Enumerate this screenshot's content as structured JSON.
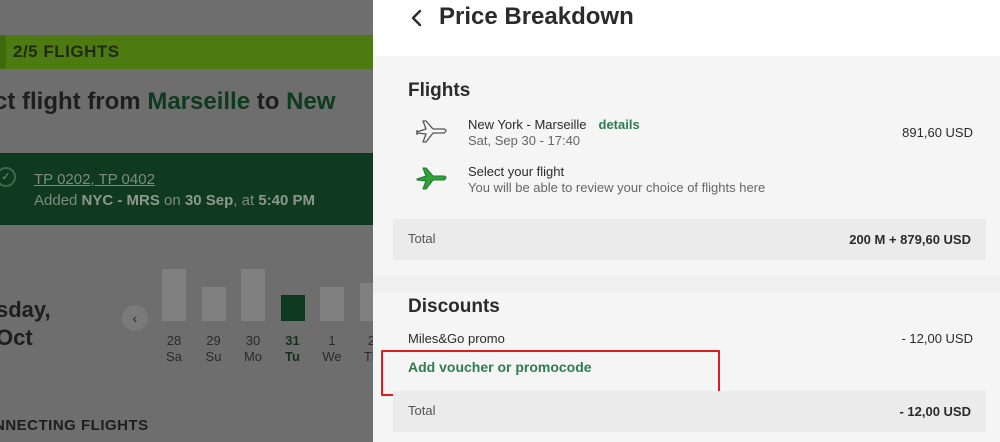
{
  "background": {
    "step_label": "2/5 FLIGHTS",
    "heading_prefix": "ct flight from ",
    "heading_origin": "Marseille",
    "heading_to": " to ",
    "heading_dest": "New",
    "selected_codes": "TP 0202, TP 0402",
    "selected_added_prefix": "Added ",
    "selected_route": "NYC - MRS",
    "selected_on": " on ",
    "selected_date": "30 Sep",
    "selected_at": ", at ",
    "selected_time": "5:40 PM",
    "date_line1": "sday,",
    "date_line2": "Oct",
    "arrow": "‹",
    "calendar": [
      {
        "day": "28",
        "dow": "Sa",
        "level": 0.58
      },
      {
        "day": "29",
        "dow": "Su",
        "level": 0.38
      },
      {
        "day": "30",
        "dow": "Mo",
        "level": 0.58
      },
      {
        "day": "31",
        "dow": "Tu",
        "level": 0.29,
        "selected": true
      },
      {
        "day": "1",
        "dow": "We",
        "level": 0.38
      },
      {
        "day": "2",
        "dow": "Th",
        "level": 0.42
      }
    ],
    "connecting_label": "NNECTING FLIGHTS"
  },
  "panel": {
    "title": "Price Breakdown",
    "flights": {
      "title": "Flights",
      "items": [
        {
          "route": "New York - Marseille",
          "link": "details",
          "date": "Sat, Sep 30 - 17:40",
          "price": "891,60 USD"
        },
        {
          "route": "Select your flight",
          "date": "You will be able to review your choice of flights here",
          "price": ""
        }
      ],
      "total_label": "Total",
      "total_value": "200 M + 879,60 USD"
    },
    "discounts": {
      "title": "Discounts",
      "promo_label": "Miles&Go promo",
      "promo_amount": "- 12,00 USD",
      "voucher_link": "Add voucher or promocode",
      "total_label": "Total",
      "total_value": "- 12,00 USD"
    }
  },
  "colors": {
    "accent_green": "#2e7d4f",
    "highlight_red": "#e01b24",
    "plane_green": "#2fa33a"
  },
  "icons": {
    "back": "chevron-left-icon",
    "flight_booked": "plane-outline-icon",
    "flight_pending": "plane-green-icon"
  }
}
